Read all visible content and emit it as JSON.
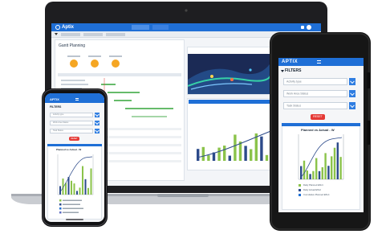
{
  "app": {
    "name": "Aptix",
    "tabs": [
      "",
      ""
    ],
    "page_title": "Gantt Planning"
  },
  "tablet": {
    "brand": "APTIX",
    "filters_label": "FILTERS",
    "selects": [
      "Activity type",
      "Work Area Status",
      "Task Status"
    ],
    "reset_label": "RESET",
    "chart_title": "Planned vs Actual - W",
    "legend": [
      "Daily Planned Effort",
      "Daily Actual Effort",
      "Cumulative Planned Effort"
    ]
  },
  "phone": {
    "brand": "APTIX",
    "filters_label": "FILTERS",
    "chart_title": "Planned vs Actual - W"
  },
  "colors": {
    "brand_blue": "#1f6fd6",
    "accent_blue": "#2f7de1",
    "bar_green": "#8bc34a",
    "bar_navy": "#2c4a8a",
    "reset_red": "#e53935"
  }
}
